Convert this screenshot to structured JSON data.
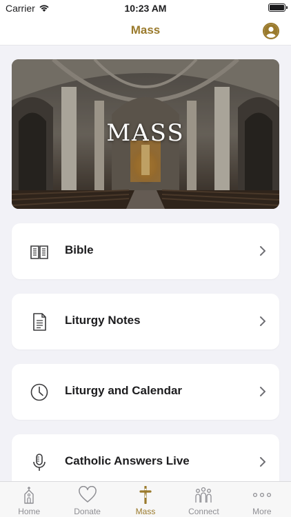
{
  "status_bar": {
    "carrier": "Carrier",
    "time": "10:23 AM"
  },
  "nav": {
    "title": "Mass",
    "profile_icon": "person-circle-icon"
  },
  "hero": {
    "title": "MASS"
  },
  "menu": [
    {
      "label": "Bible",
      "icon": "open-book-icon"
    },
    {
      "label": "Liturgy Notes",
      "icon": "document-icon"
    },
    {
      "label": "Liturgy and Calendar",
      "icon": "clock-icon"
    },
    {
      "label": "Catholic Answers Live",
      "icon": "microphone-icon"
    }
  ],
  "tabs": [
    {
      "label": "Home",
      "icon": "church-icon",
      "active": false
    },
    {
      "label": "Donate",
      "icon": "heart-icon",
      "active": false
    },
    {
      "label": "Mass",
      "icon": "crucifix-icon",
      "active": true
    },
    {
      "label": "Connect",
      "icon": "people-icon",
      "active": false
    },
    {
      "label": "More",
      "icon": "more-dots-icon",
      "active": false
    }
  ],
  "colors": {
    "accent": "#9a7a2c",
    "background": "#f2f2f7",
    "inactive_tab": "#8e8e93"
  }
}
